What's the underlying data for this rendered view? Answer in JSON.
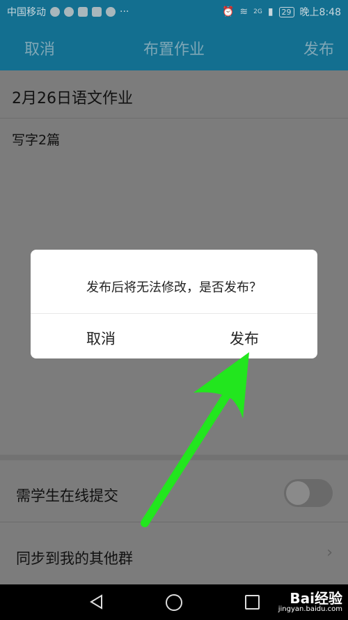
{
  "status_bar": {
    "carrier": "中国移动",
    "signal": "2G",
    "battery": "29",
    "time": "晚上8:48"
  },
  "app_bar": {
    "cancel_label": "取消",
    "title": "布置作业",
    "publish_label": "发布"
  },
  "homework": {
    "title": "2月26日语文作业",
    "body": "写字2篇"
  },
  "settings": {
    "online_submit_label": "需学生在线提交",
    "online_submit_enabled": false,
    "sync_label": "同步到我的其他群"
  },
  "dialog": {
    "message": "发布后将无法修改，是否发布？",
    "cancel_label": "取消",
    "publish_label": "发布"
  },
  "watermark": {
    "brand": "Bai经验",
    "url": "jingyan.baidu.com"
  },
  "colors": {
    "header": "#136f90",
    "overlay_bg": "#7c7c7c",
    "arrow": "#22e61e"
  }
}
